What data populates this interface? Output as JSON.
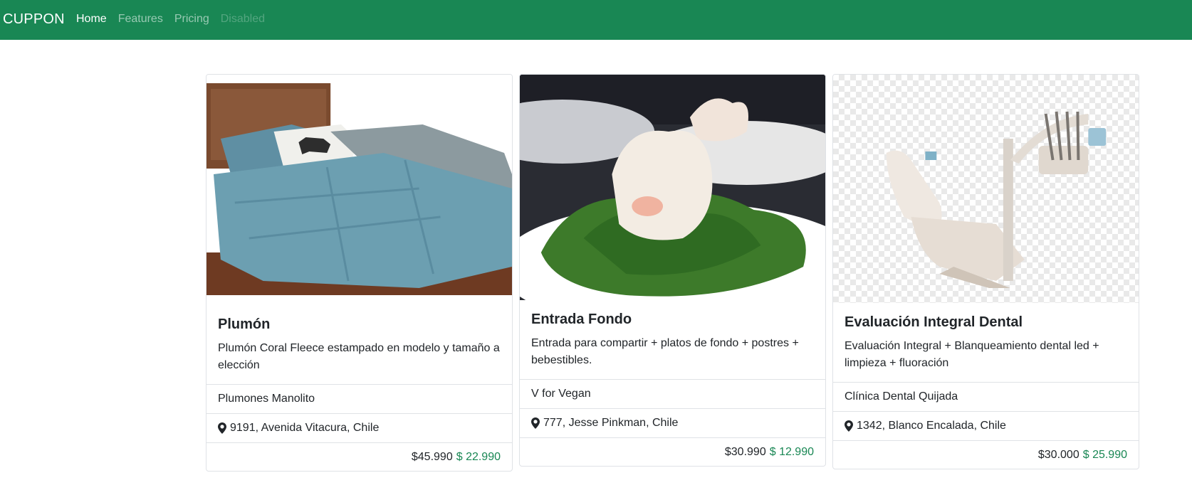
{
  "navbar": {
    "brand": "CUPPON",
    "links": [
      "Home",
      "Features",
      "Pricing",
      "Disabled"
    ]
  },
  "cards": [
    {
      "image": "bed-comforter-photo",
      "title": "Plumón",
      "text": "Plumón Coral Fleece estampado en modelo y tamaño a elección",
      "store": "Plumones Manolito",
      "address": "9191, Avenida Vitacura, Chile",
      "price_old": "$45.990",
      "price_new": "$ 22.990"
    },
    {
      "image": "seafood-salad-photo",
      "title": "Entrada Fondo",
      "text": "Entrada para compartir + platos de fondo + postres + bebestibles.",
      "store": "V for Vegan",
      "address": "777, Jesse Pinkman, Chile",
      "price_old": "$30.990",
      "price_new": "$ 12.990"
    },
    {
      "image": "dental-chair-photo",
      "title": "Evaluación Integral Dental",
      "text": "Evaluación Integral + Blanqueamiento dental led + limpieza + fluoración",
      "store": "Clínica Dental Quijada",
      "address": "1342, Blanco Encalada, Chile",
      "price_old": "$30.000",
      "price_new": "$ 25.990"
    }
  ],
  "colors": {
    "navbar": "#198754",
    "price_new": "#198754"
  }
}
